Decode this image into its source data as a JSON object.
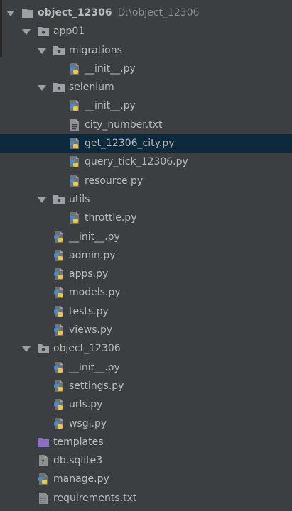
{
  "tree": [
    {
      "depth": 0,
      "kind": "project-folder",
      "label": "object_12306",
      "path": "D:\\object_12306",
      "expanded": true,
      "bold": true
    },
    {
      "depth": 1,
      "kind": "package",
      "label": "app01",
      "expanded": true
    },
    {
      "depth": 2,
      "kind": "package",
      "label": "migrations",
      "expanded": true
    },
    {
      "depth": 3,
      "kind": "py",
      "label": "__init__.py"
    },
    {
      "depth": 2,
      "kind": "package",
      "label": "selenium",
      "expanded": true
    },
    {
      "depth": 3,
      "kind": "py",
      "label": "__init__.py"
    },
    {
      "depth": 3,
      "kind": "txt",
      "label": "city_number.txt"
    },
    {
      "depth": 3,
      "kind": "py",
      "label": "get_12306_city.py",
      "selected": true
    },
    {
      "depth": 3,
      "kind": "py",
      "label": "query_tick_12306.py"
    },
    {
      "depth": 3,
      "kind": "py",
      "label": "resource.py"
    },
    {
      "depth": 2,
      "kind": "package",
      "label": "utils",
      "expanded": true
    },
    {
      "depth": 3,
      "kind": "py",
      "label": "throttle.py"
    },
    {
      "depth": 2,
      "kind": "py",
      "label": "__init__.py"
    },
    {
      "depth": 2,
      "kind": "py",
      "label": "admin.py"
    },
    {
      "depth": 2,
      "kind": "py",
      "label": "apps.py"
    },
    {
      "depth": 2,
      "kind": "py",
      "label": "models.py"
    },
    {
      "depth": 2,
      "kind": "py",
      "label": "tests.py"
    },
    {
      "depth": 2,
      "kind": "py",
      "label": "views.py"
    },
    {
      "depth": 1,
      "kind": "package",
      "label": "object_12306",
      "expanded": true
    },
    {
      "depth": 2,
      "kind": "py",
      "label": "__init__.py"
    },
    {
      "depth": 2,
      "kind": "py",
      "label": "settings.py"
    },
    {
      "depth": 2,
      "kind": "py",
      "label": "urls.py"
    },
    {
      "depth": 2,
      "kind": "py",
      "label": "wsgi.py"
    },
    {
      "depth": 1,
      "kind": "templates",
      "label": "templates"
    },
    {
      "depth": 1,
      "kind": "sqlite",
      "label": "db.sqlite3"
    },
    {
      "depth": 1,
      "kind": "py",
      "label": "manage.py"
    },
    {
      "depth": 1,
      "kind": "txt",
      "label": "requirements.txt"
    }
  ],
  "icons": {
    "project-folder": "folder-icon",
    "package": "package-folder-icon",
    "py": "python-file-icon",
    "txt": "text-file-icon",
    "templates": "templates-folder-icon",
    "sqlite": "sqlite-file-icon"
  },
  "colors": {
    "background": "#3c3f41",
    "selection": "#0d293e",
    "text": "#bbbbbb",
    "path_text": "#8c8c8c",
    "folder": "#9aa0a6",
    "templates_folder": "#8c6fc1",
    "python_blue": "#4a8ac7",
    "python_yellow": "#f2c743"
  }
}
